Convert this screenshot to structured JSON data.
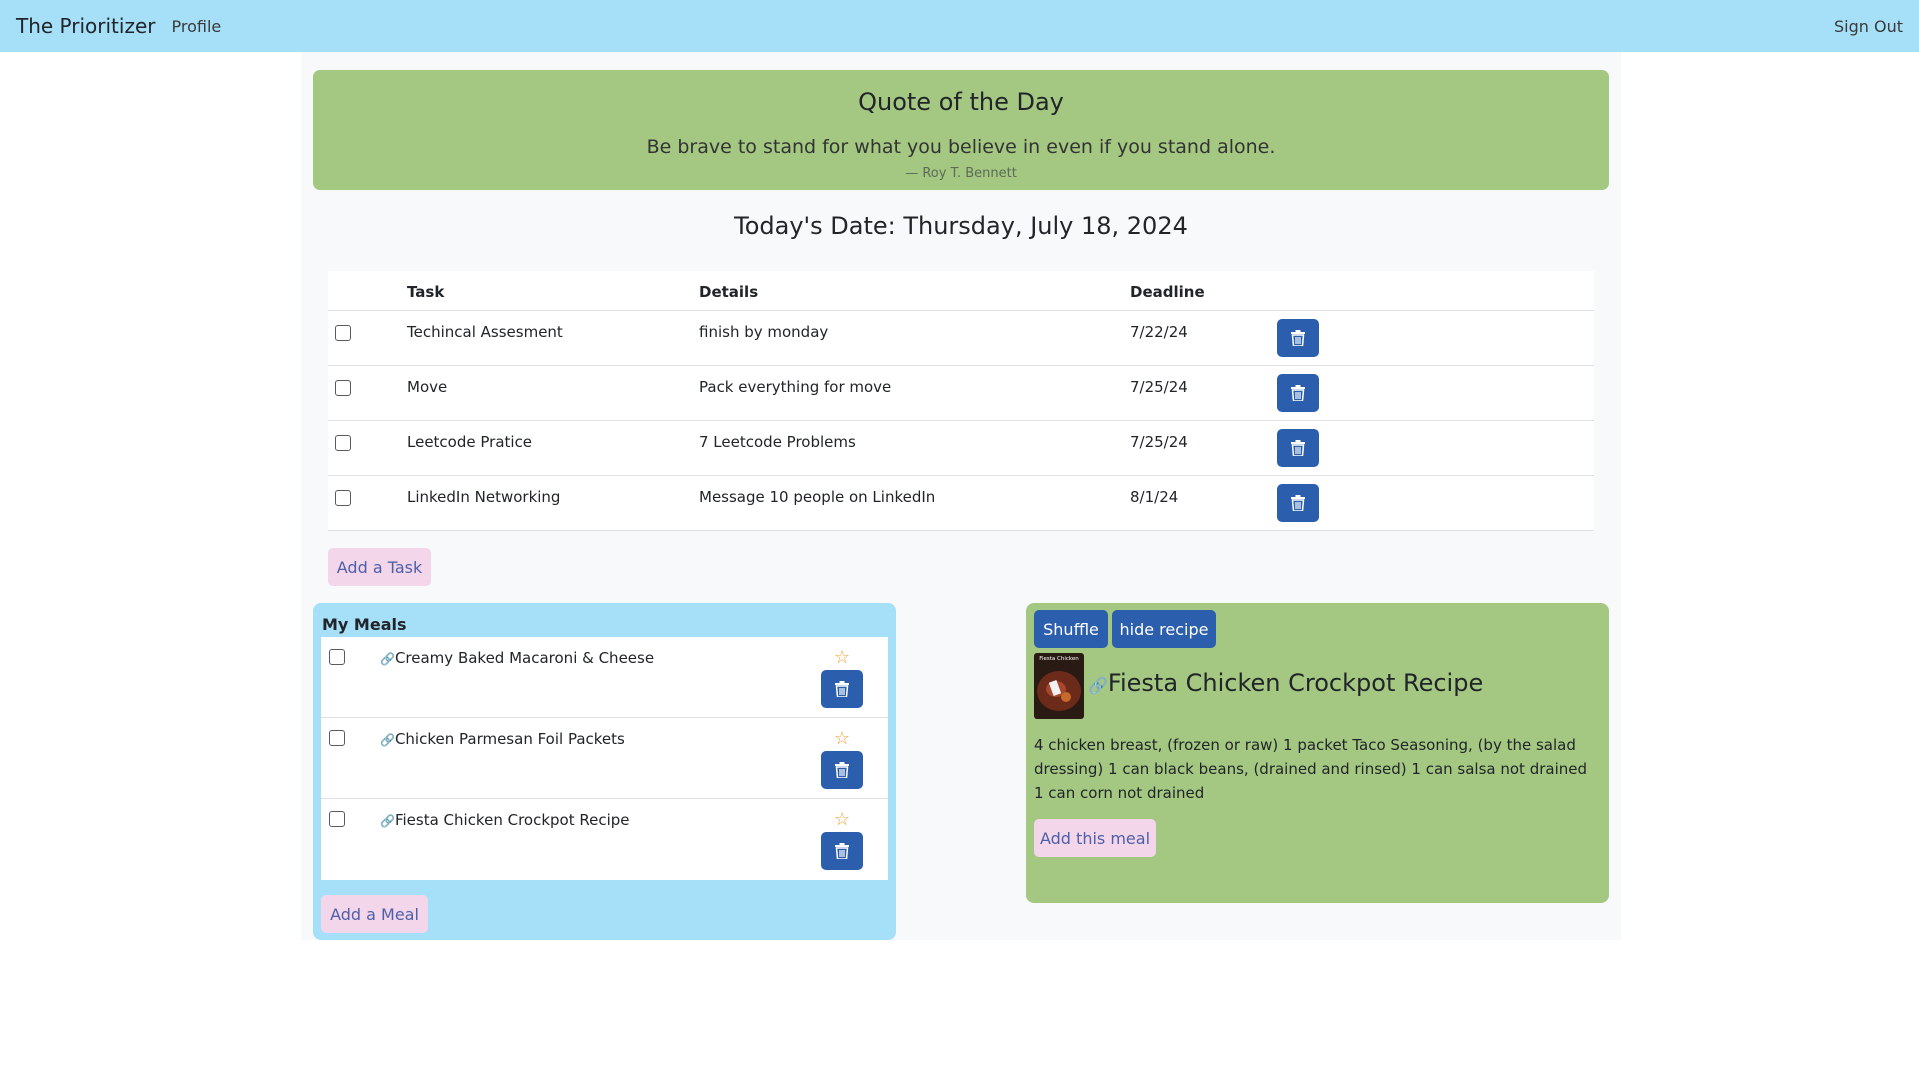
{
  "navbar": {
    "brand": "The Prioritizer",
    "profile": "Profile",
    "sign_out": "Sign Out"
  },
  "quote": {
    "title": "Quote of the Day",
    "text": "Be brave to stand for what you believe in even if you stand alone.",
    "author": "— Roy T. Bennett"
  },
  "date_heading": "Today's Date: Thursday, July 18, 2024",
  "tasks": {
    "headers": {
      "task": "Task",
      "details": "Details",
      "deadline": "Deadline"
    },
    "rows": [
      {
        "task": "Techincal Assesment",
        "details": "finish by monday",
        "deadline": "7/22/24"
      },
      {
        "task": "Move",
        "details": "Pack everything for move",
        "deadline": "7/25/24"
      },
      {
        "task": "Leetcode Pratice",
        "details": "7 Leetcode Problems",
        "deadline": "7/25/24"
      },
      {
        "task": "LinkedIn Networking",
        "details": "Message 10 people on LinkedIn",
        "deadline": "8/1/24"
      }
    ],
    "add_label": "Add a Task"
  },
  "meals": {
    "title": "My Meals",
    "items": [
      {
        "name": "Creamy Baked Macaroni & Cheese"
      },
      {
        "name": "Chicken Parmesan Foil Packets"
      },
      {
        "name": "Fiesta Chicken Crockpot Recipe"
      }
    ],
    "add_label": "Add a Meal"
  },
  "recipe": {
    "shuffle_label": "Shuffle",
    "hide_label": "hide recipe",
    "title": "Fiesta Chicken Crockpot Recipe",
    "description": "4 chicken breast, (frozen or raw) 1 packet Taco Seasoning, (by the salad dressing) 1 can black beans, (drained and rinsed) 1 can salsa not drained 1 can corn not drained",
    "add_label": "Add this meal",
    "image_caption": "Fiesta Chicken"
  },
  "colors": {
    "navbar": "#a5dff8",
    "quote_card": "#a4c882",
    "primary_button": "#2b5ead",
    "add_button": "#f3d6ea",
    "star": "#f0a53a"
  },
  "icons": {
    "delete": "trash-icon",
    "link": "link-icon",
    "favorite": "star-icon"
  }
}
